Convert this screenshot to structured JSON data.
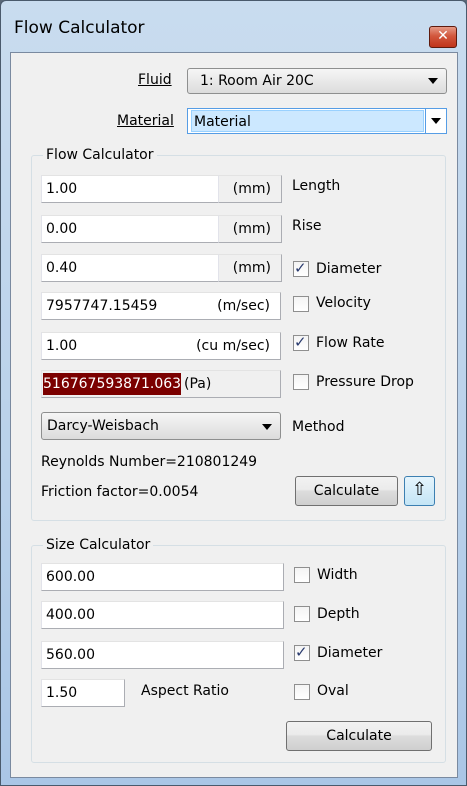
{
  "window": {
    "title": "Flow Calculator",
    "close_icon": "close-icon"
  },
  "top": {
    "fluid_label": "Fluid",
    "fluid_value": "1: Room Air 20C",
    "material_label": "Material",
    "material_value": "Material"
  },
  "flow": {
    "title": "Flow Calculator",
    "length": {
      "value": "1.00",
      "unit": "(mm)",
      "label": "Length"
    },
    "rise": {
      "value": "0.00",
      "unit": "(mm)",
      "label": "Rise"
    },
    "diameter": {
      "value": "0.40",
      "unit": "(mm)",
      "label": "Diameter",
      "checked": true
    },
    "velocity": {
      "value": "7957747.15459",
      "unit": "(m/sec)",
      "label": "Velocity",
      "checked": false
    },
    "flow_rate": {
      "value": "1.00",
      "unit": "(cu m/sec)",
      "label": "Flow Rate",
      "checked": true
    },
    "pressure_drop": {
      "value": "516767593871.063",
      "unit": "(Pa)",
      "label": "Pressure Drop",
      "checked": false
    },
    "method_value": "Darcy-Weisbach",
    "method_label": "Method",
    "reynolds": "Reynolds Number=210801249",
    "friction": "Friction factor=0.0054",
    "calculate": "Calculate",
    "up_icon": "arrow-up-icon"
  },
  "size": {
    "title": "Size Calculator",
    "width": {
      "value": "600.00",
      "label": "Width",
      "checked": false
    },
    "depth": {
      "value": "400.00",
      "label": "Depth",
      "checked": false
    },
    "diameter": {
      "value": "560.00",
      "label": "Diameter",
      "checked": true
    },
    "aspect": {
      "value": "1.50",
      "label": "Aspect Ratio"
    },
    "oval": {
      "label": "Oval",
      "checked": false
    },
    "calculate": "Calculate"
  },
  "colors": {
    "highlight": "#7b0000",
    "accent": "#569de5"
  }
}
